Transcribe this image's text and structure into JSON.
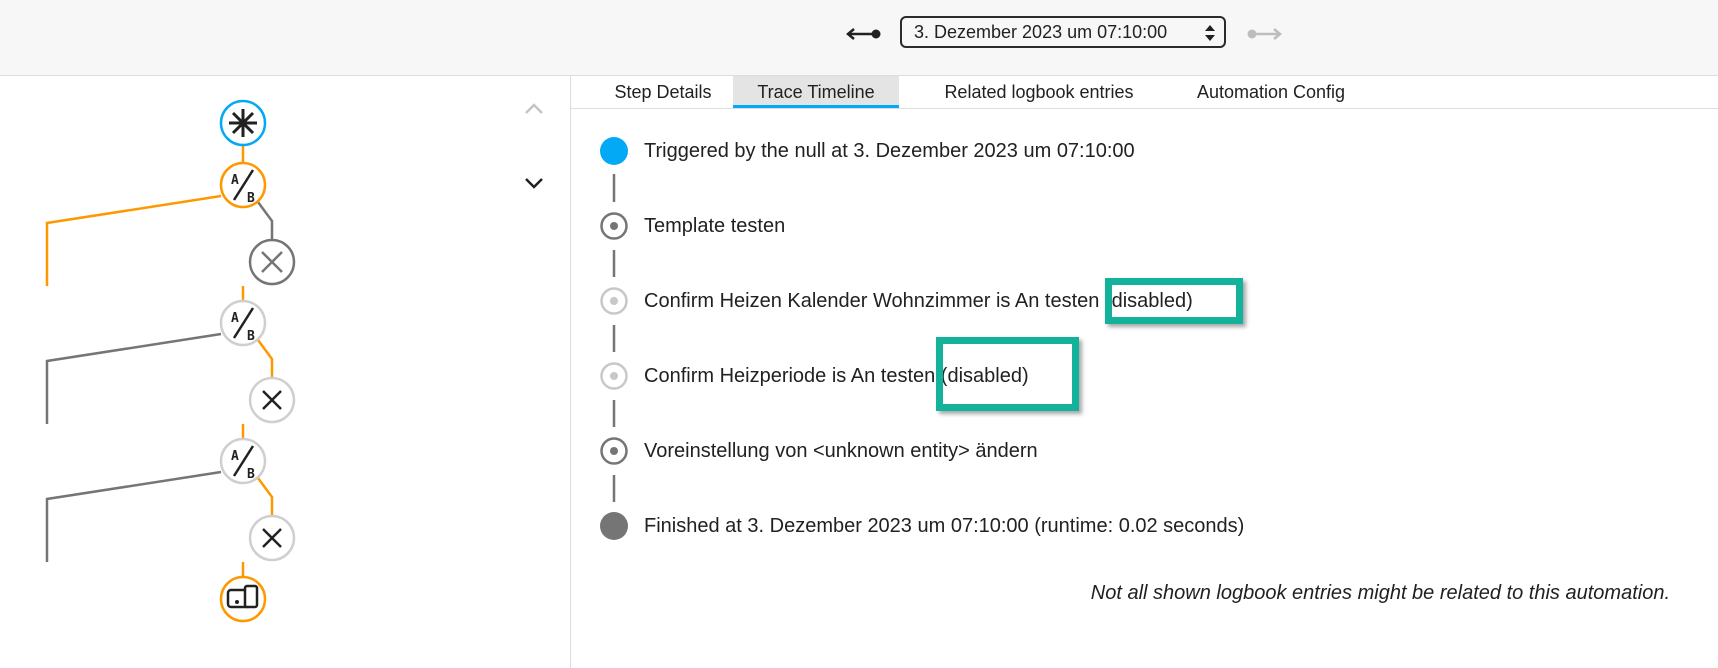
{
  "header": {
    "trace_value": "3. Dezember 2023 um 07:10:00",
    "prev_icon": "arrow-left-stop-icon",
    "next_icon": "arrow-right-stop-icon"
  },
  "graph": {
    "collapse_icon": "chevron-up-icon",
    "expand_icon": "chevron-down-icon",
    "nodes": [
      "trigger-asterisk-icon",
      "condition-ab-icon",
      "close-icon",
      "condition-ab-icon",
      "close-icon",
      "condition-ab-icon",
      "close-icon",
      "device-action-icon"
    ]
  },
  "tabs": [
    "Step Details",
    "Trace Timeline",
    "Related logbook entries",
    "Automation Config"
  ],
  "active_tab": "Trace Timeline",
  "timeline": {
    "entries": [
      "Triggered by the null at 3. Dezember 2023 um 07:10:00",
      "Template testen",
      "Confirm Heizen Kalender Wohnzimmer is An testen (disabled)",
      "Confirm Heizperiode is An testen (disabled)",
      "Voreinstellung von <unknown entity> ändern",
      "Finished at 3. Dezember 2023 um 07:10:00 (runtime: 0.02 seconds)"
    ]
  },
  "note": "Not all shown logbook entries might be related to this automation.",
  "colors": {
    "accent": "#03a9f4",
    "branch": "#ff9800",
    "inactive": "#757575",
    "highlight": "#12b39a"
  }
}
